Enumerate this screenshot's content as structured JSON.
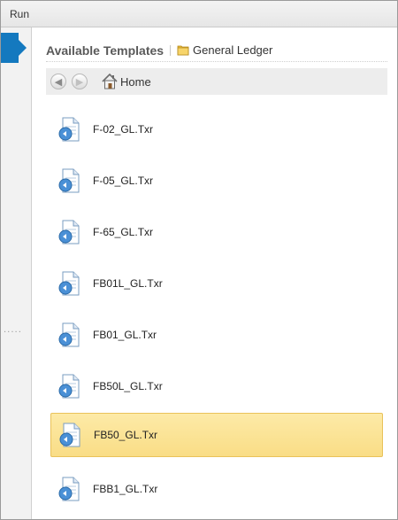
{
  "window": {
    "title": "Run"
  },
  "header": {
    "title": "Available Templates",
    "breadcrumb": "General Ledger"
  },
  "nav": {
    "home_label": "Home"
  },
  "files": [
    {
      "name": "F-02_GL.Txr",
      "selected": false
    },
    {
      "name": "F-05_GL.Txr",
      "selected": false
    },
    {
      "name": "F-65_GL.Txr",
      "selected": false
    },
    {
      "name": "FB01L_GL.Txr",
      "selected": false
    },
    {
      "name": "FB01_GL.Txr",
      "selected": false
    },
    {
      "name": "FB50L_GL.Txr",
      "selected": false
    },
    {
      "name": "FB50_GL.Txr",
      "selected": true
    },
    {
      "name": "FBB1_GL.Txr",
      "selected": false
    }
  ],
  "colors": {
    "accent": "#1479bf",
    "selection": "#fbe39a"
  }
}
